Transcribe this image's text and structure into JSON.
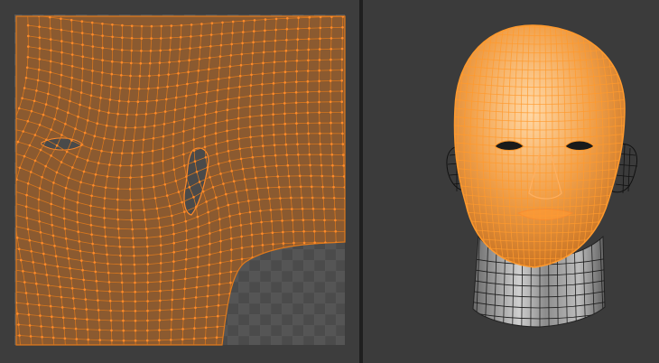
{
  "uv_editor": {
    "panel": "uv-image-editor",
    "background_color": "#3d3d3d",
    "checker_colors": [
      "#4a4a4a",
      "#545454"
    ],
    "island_fill": "#8a5a32",
    "edge_color": "#e07a1c",
    "vertex_color": "#ff8a2a",
    "grid_lines_color": "#2e2e2e"
  },
  "viewport_3d": {
    "panel": "3d-viewport",
    "background_color": "#3b3b3b",
    "selected_face_color": "#f0a64a",
    "selected_wire_color": "#ff9a2e",
    "unselected_wire_color": "#111111",
    "neck_shading": [
      "#9a9a9a",
      "#d8d8d8",
      "#6e6e6e"
    ]
  }
}
